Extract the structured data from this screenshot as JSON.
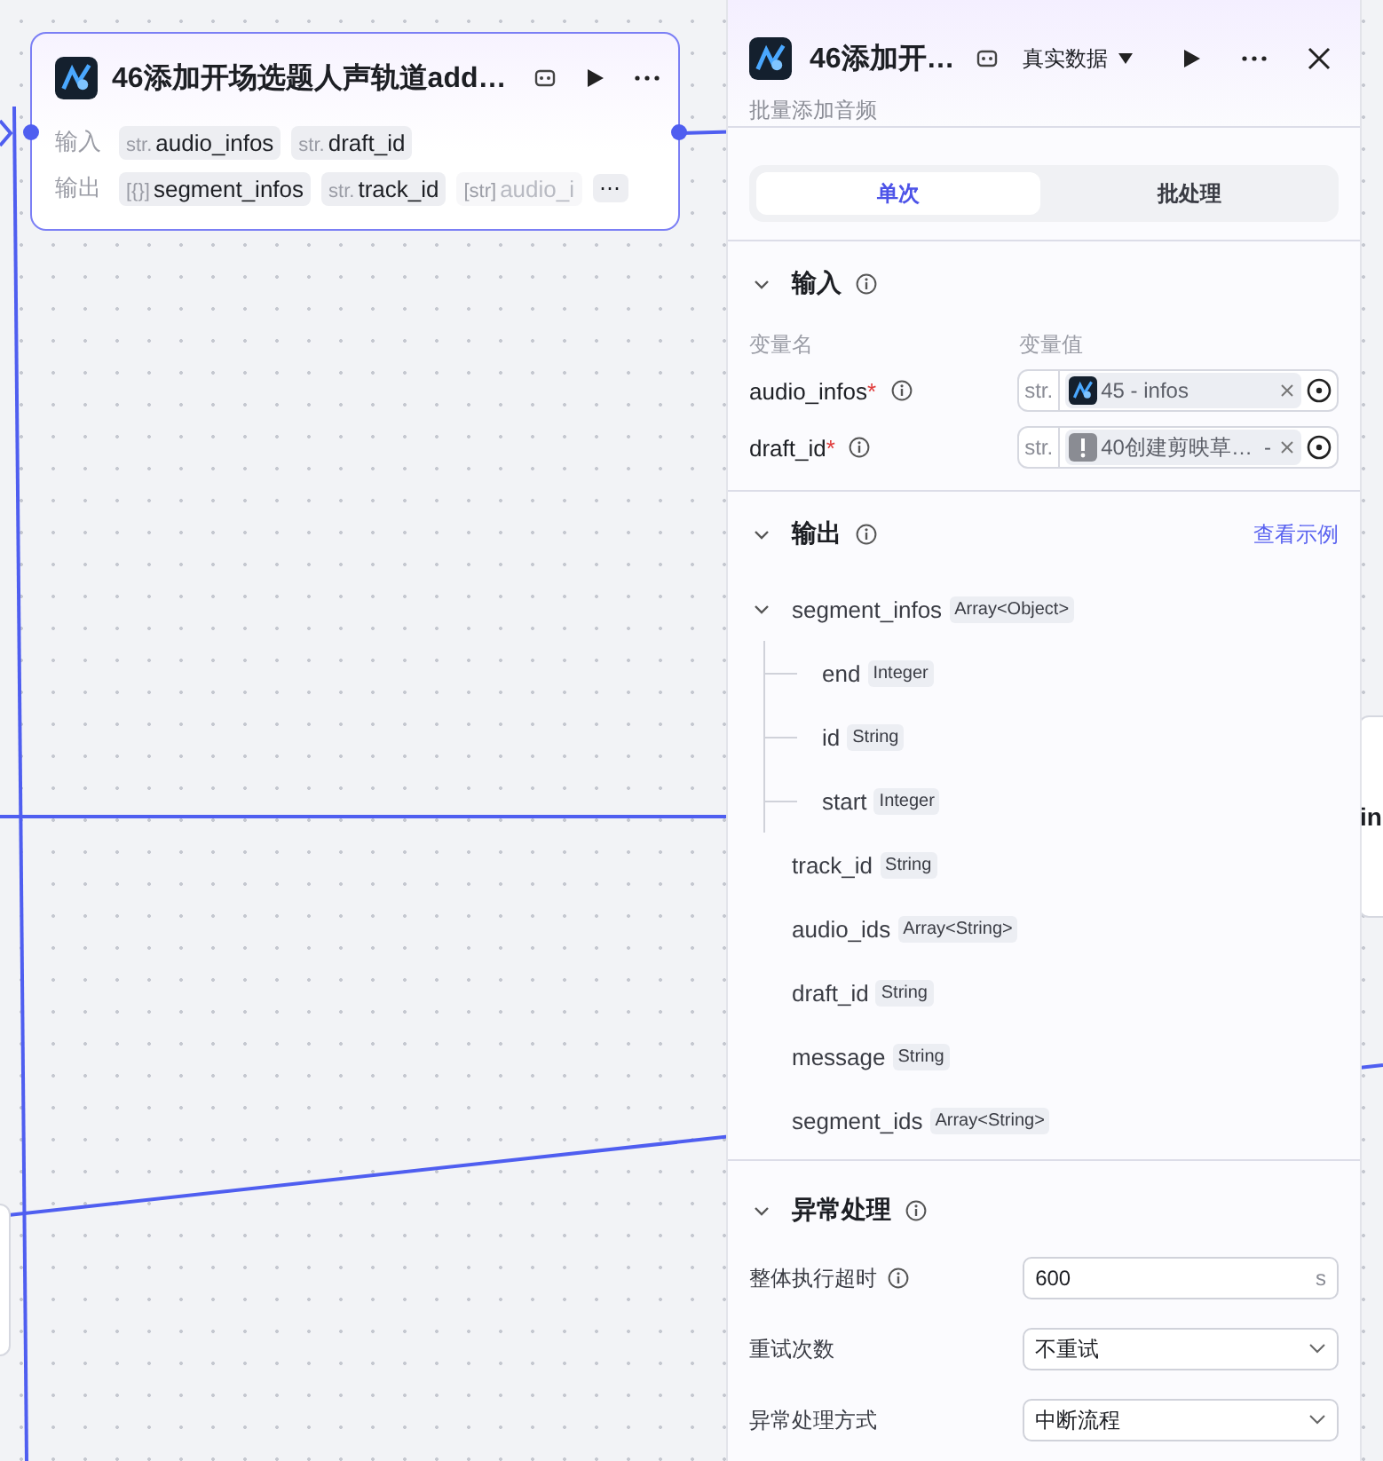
{
  "canvas_node": {
    "title": "46添加开场选题人声轨道add…",
    "input_label": "输入",
    "inputs": [
      {
        "type": "str.",
        "name": "audio_infos"
      },
      {
        "type": "str.",
        "name": "draft_id"
      }
    ],
    "output_label": "输出",
    "outputs": [
      {
        "type": "[{}]",
        "name": "segment_infos",
        "faded": false
      },
      {
        "type": "str.",
        "name": "track_id",
        "faded": false
      },
      {
        "type": "[str]",
        "name": "audio_i",
        "faded": true
      }
    ],
    "more": "⋯"
  },
  "partial_node": {
    "text": "in"
  },
  "panel": {
    "title": "46添加开…",
    "data_mode": "真实数据",
    "subtitle": "批量添加音频",
    "tabs": [
      {
        "label": "单次",
        "selected": true
      },
      {
        "label": "批处理",
        "selected": false
      }
    ],
    "input_section": {
      "title": "输入",
      "expanded": true,
      "name_header": "变量名",
      "value_header": "变量值",
      "rows": [
        {
          "name": "audio_infos",
          "required_mark": "*",
          "type": "str.",
          "kind": "app",
          "value": "45 - infos",
          "suffix": ""
        },
        {
          "name": "draft_id",
          "required_mark": "*",
          "type": "str.",
          "kind": "warning",
          "value": "40创建剪映草…",
          "suffix": "-"
        }
      ]
    },
    "output_section": {
      "title": "输出",
      "expanded": true,
      "link": "查看示例",
      "fields": [
        {
          "name": "segment_infos",
          "type": "Array<Object>",
          "expanded": true,
          "children": [
            {
              "name": "end",
              "type": "Integer"
            },
            {
              "name": "id",
              "type": "String"
            },
            {
              "name": "start",
              "type": "Integer"
            }
          ]
        },
        {
          "name": "track_id",
          "type": "String"
        },
        {
          "name": "audio_ids",
          "type": "Array<String>"
        },
        {
          "name": "draft_id",
          "type": "String"
        },
        {
          "name": "message",
          "type": "String"
        },
        {
          "name": "segment_ids",
          "type": "Array<String>"
        }
      ]
    },
    "error_section": {
      "title": "异常处理",
      "expanded": true,
      "rows": [
        {
          "kind": "input",
          "label": "整体执行超时",
          "info": true,
          "value": "600",
          "unit": "s"
        },
        {
          "kind": "select",
          "label": "重试次数",
          "info": false,
          "value": "不重试"
        },
        {
          "kind": "select",
          "label": "异常处理方式",
          "info": false,
          "value": "中断流程"
        }
      ]
    }
  }
}
